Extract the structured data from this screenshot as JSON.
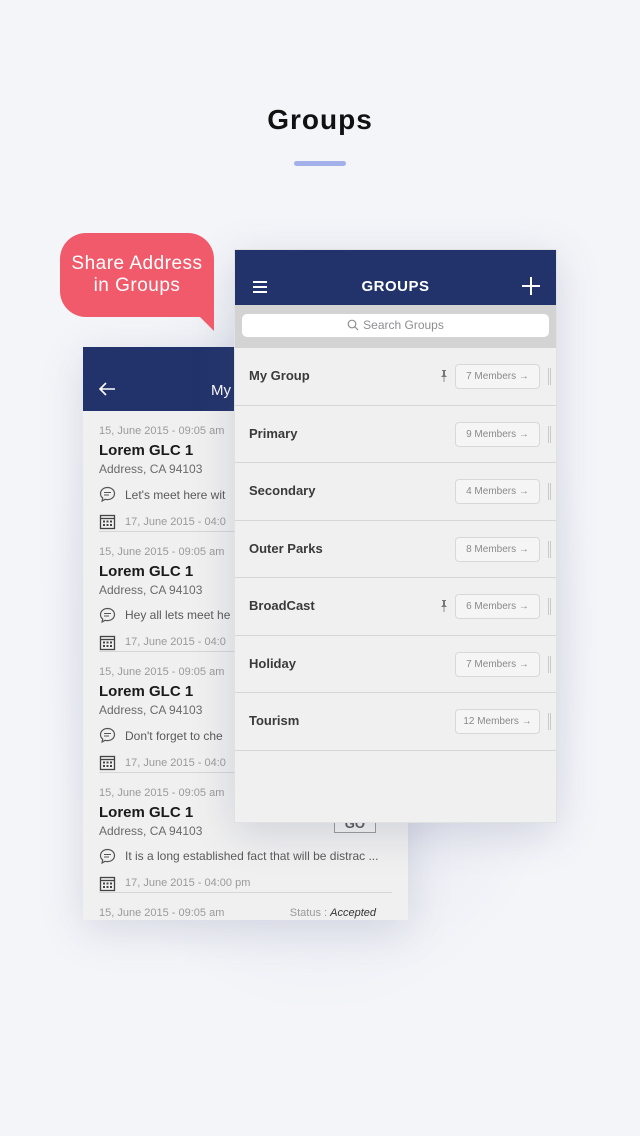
{
  "page": {
    "title": "Groups"
  },
  "bubble": {
    "line1": "Share Address",
    "line2": "in Groups"
  },
  "back_screen": {
    "title": "My",
    "messages": [
      {
        "date": "15, June 2015  -  09:05 am",
        "name": "Lorem GLC 1",
        "address": "Address, CA 94103",
        "text": "Let's meet here wit",
        "schedule": "17, June 2015  -  04:0"
      },
      {
        "date": "15, June 2015  -  09:05 am",
        "name": "Lorem GLC 1",
        "address": "Address, CA 94103",
        "text": "Hey all lets meet he",
        "schedule": "17, June 2015  -  04:0"
      },
      {
        "date": "15, June 2015  -  09:05 am",
        "name": "Lorem GLC 1",
        "address": "Address, CA 94103",
        "text": "Don't forget to che",
        "schedule": "17, June 2015  -  04:0"
      },
      {
        "date": "15, June 2015  -  09:05 am",
        "name": "Lorem GLC 1",
        "address": "Address, CA 94103",
        "text": "It is a long established fact that will be distrac ...",
        "schedule": "17, June 2015  -  04:00 pm",
        "go": "GO"
      }
    ],
    "last": {
      "date": "15, June 2015  -  09:05 am",
      "status_label": "Status : ",
      "status_value": "Accepted"
    }
  },
  "front_screen": {
    "title": "GROUPS",
    "search_placeholder": "Search Groups",
    "groups": [
      {
        "name": "My Group",
        "members": "7 Members →",
        "pinned": true
      },
      {
        "name": "Primary",
        "members": "9 Members →",
        "pinned": false
      },
      {
        "name": "Secondary",
        "members": "4 Members →",
        "pinned": false
      },
      {
        "name": "Outer Parks",
        "members": "8 Members →",
        "pinned": false
      },
      {
        "name": "BroadCast",
        "members": "6 Members →",
        "pinned": true
      },
      {
        "name": "Holiday",
        "members": "7 Members →",
        "pinned": false
      },
      {
        "name": "Tourism",
        "members": "12 Members →",
        "pinned": false
      }
    ]
  },
  "colors": {
    "header": "#22336b",
    "bubble": "#f05a6b",
    "accent_line": "#a3b1ea"
  }
}
